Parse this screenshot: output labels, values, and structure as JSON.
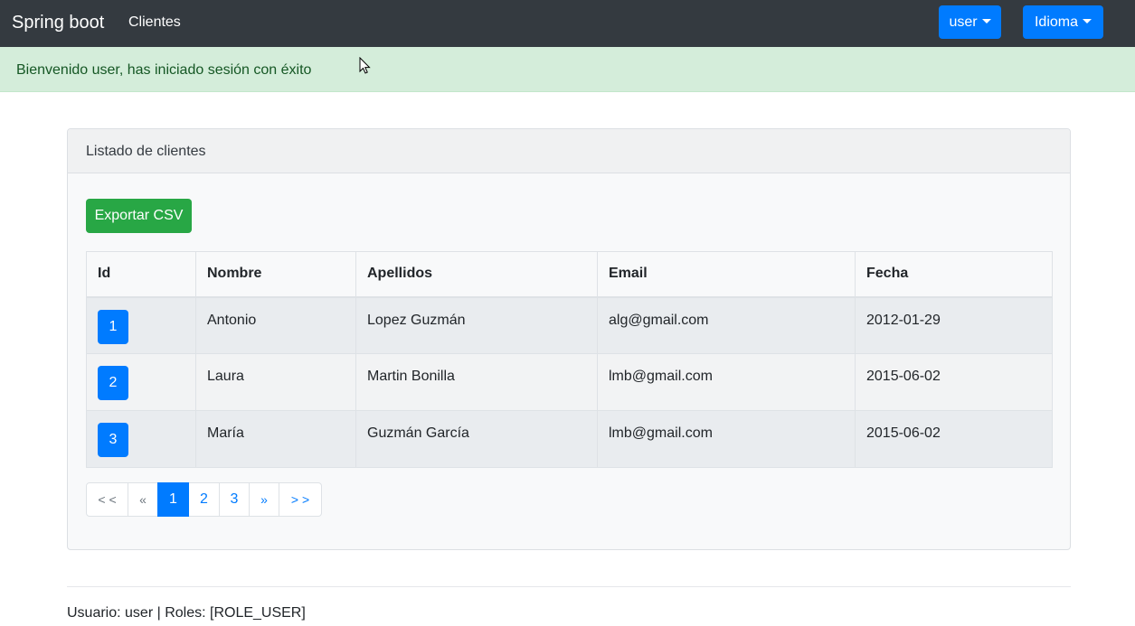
{
  "navbar": {
    "brand": "Spring boot",
    "link_clientes": "Clientes",
    "user_menu": "user",
    "language_menu": "Idioma"
  },
  "alert": {
    "message": "Bienvenido user, has iniciado sesión con éxito"
  },
  "card": {
    "header": "Listado de clientes",
    "export_button": "Exportar CSV",
    "table": {
      "columns": [
        "Id",
        "Nombre",
        "Apellidos",
        "Email",
        "Fecha"
      ],
      "rows": [
        {
          "id": "1",
          "nombre": "Antonio",
          "apellidos": "Lopez Guzmán",
          "email": "alg@gmail.com",
          "fecha": "2012-01-29"
        },
        {
          "id": "2",
          "nombre": "Laura",
          "apellidos": "Martin Bonilla",
          "email": "lmb@gmail.com",
          "fecha": "2015-06-02"
        },
        {
          "id": "3",
          "nombre": "María",
          "apellidos": "Guzmán García",
          "email": "lmb@gmail.com",
          "fecha": "2015-06-02"
        }
      ]
    },
    "pagination": {
      "first": "< <",
      "prev": "«",
      "pages": [
        "1",
        "2",
        "3"
      ],
      "active_page": "1",
      "next": "»",
      "last": "> >"
    }
  },
  "footer": {
    "text": "Usuario: user | Roles: [ROLE_USER]"
  },
  "colors": {
    "navbar": "#343a40",
    "primary": "#007bff",
    "success": "#28a745",
    "alert_bg": "#d4edda",
    "alert_text": "#155724"
  }
}
